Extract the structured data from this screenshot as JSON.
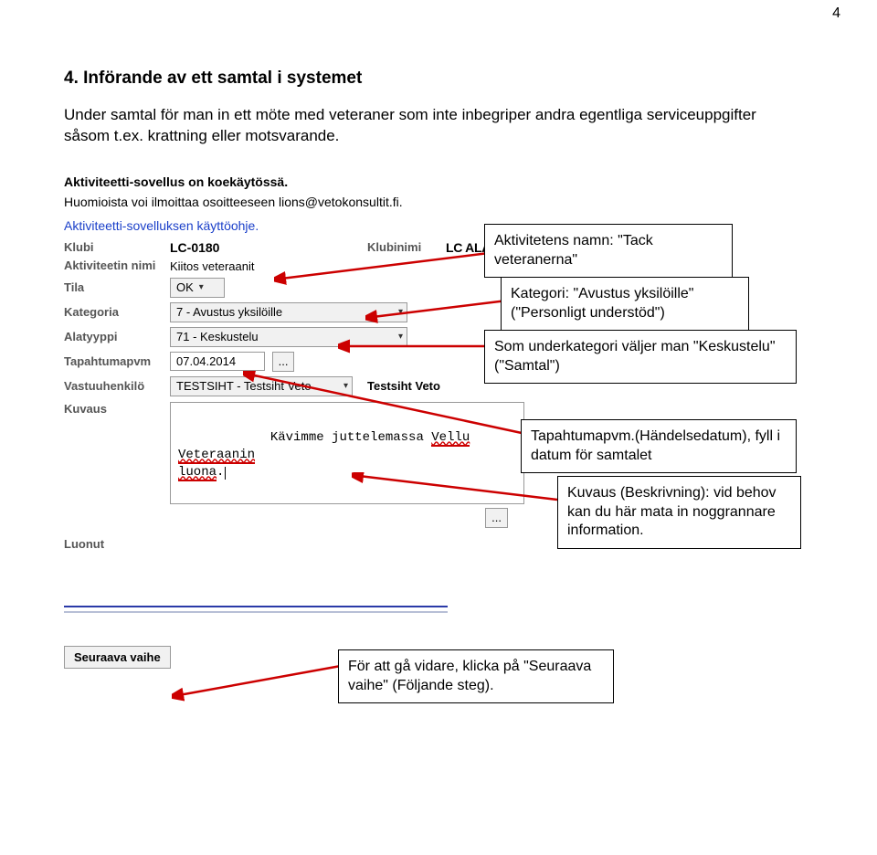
{
  "page_number": "4",
  "heading": "4.  Införande av ett samtal i systemet",
  "paragraph": "Under samtal för man in ett möte med veteraner som inte inbegriper andra egentliga serviceuppgifter såsom t.ex. krattning eller motsvarande.",
  "app": {
    "notice1": "Aktiviteetti-sovellus on koekäytössä.",
    "notice2": "Huomioista voi ilmoittaa osoitteeseen lions@vetokonsultit.fi.",
    "link": "Aktiviteetti-sovelluksen käyttöohje.",
    "labels": {
      "klubi": "Klubi",
      "klubinimi": "Klubinimi",
      "aktiviteetin_nimi": "Aktiviteetin nimi",
      "tila": "Tila",
      "kategoria": "Kategoria",
      "alatyyppi": "Alatyyppi",
      "tapahtumapvm": "Tapahtumapvm",
      "vastuuhenkilo": "Vastuuhenkilö",
      "kuvaus": "Kuvaus",
      "luonut": "Luonut"
    },
    "values": {
      "klubi": "LC-0180",
      "klubinimi": "LC ALAHÄRMÄ",
      "aktiviteetin_nimi": "Kiitos veteraanit",
      "tila": "OK",
      "kategoria": "7 - Avustus yksilöille",
      "alatyyppi": "71 - Keskustelu",
      "tapahtumapvm": "07.04.2014",
      "datebtn": "...",
      "vastuuhenkilo": "TESTSIHT - Testsiht Veto",
      "vastuunimi": "Testsiht Veto",
      "kuvaus_line1_a": "Kävimme juttelemassa ",
      "kuvaus_line1_b": "Vellu",
      "kuvaus_line1_c": " ",
      "kuvaus_line1_d": "Veteraanin",
      "kuvaus_line2_a": "luona",
      "kuvaus_line2_b": ".",
      "dotbtn2": "..."
    },
    "nextbtn": "Seuraava vaihe"
  },
  "callouts": {
    "c1": "Aktivitetens namn: \"Tack veteranerna\"",
    "c2": "Kategori: \"Avustus yksilöille\" (\"Personligt understöd\")",
    "c3": "Som underkategori väljer man \"Keskustelu\" (\"Samtal\")",
    "c4": "Tapahtumapvm.(Händelsedatum), fyll i datum för samtalet",
    "c5": "Kuvaus (Beskrivning): vid behov kan du här mata in noggrannare information.",
    "c6": "För att gå vidare, klicka på \"Seuraava vaihe\" (Följande steg)."
  }
}
